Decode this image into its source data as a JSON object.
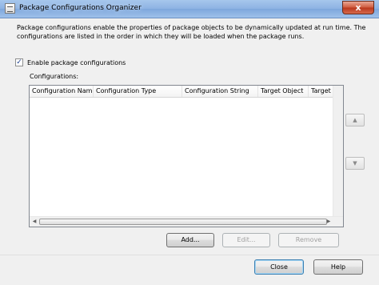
{
  "window": {
    "title": "Package Configurations Organizer",
    "close_glyph": "x"
  },
  "description": "Package configurations enable the properties of package objects to be dynamically updated at run time. The configurations are listed in the order in which they will be loaded when the package runs.",
  "enable_checkbox": {
    "label": "Enable package configurations",
    "checked": true,
    "glyph": "✓"
  },
  "configurations_label": "Configurations:",
  "columns": [
    "Configuration Name",
    "Configuration Type",
    "Configuration String",
    "Target Object",
    "Target Pro"
  ],
  "side_buttons": {
    "up": "▲",
    "down": "▼"
  },
  "buttons": {
    "add": "Add...",
    "edit": "Edit...",
    "remove": "Remove",
    "close": "Close",
    "help": "Help"
  },
  "scroll_glyphs": {
    "left": "◀",
    "right": "▶"
  }
}
